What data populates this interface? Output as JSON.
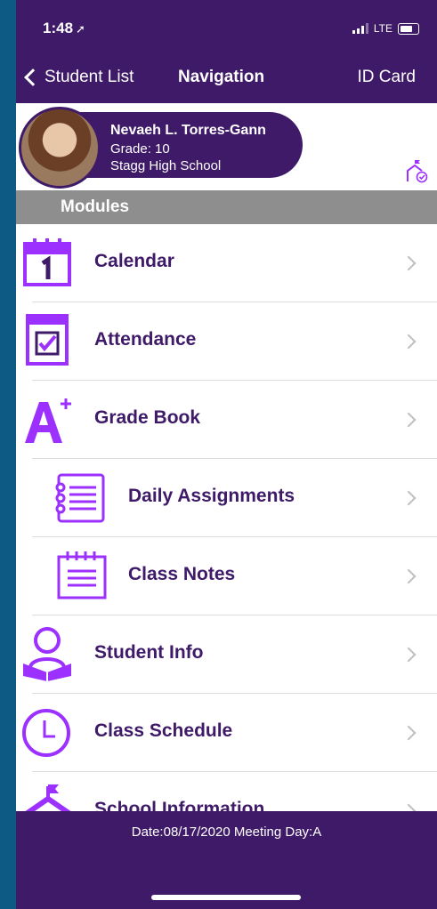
{
  "status": {
    "time": "1:48",
    "network": "LTE"
  },
  "nav": {
    "back_label": "Student List",
    "title": "Navigation",
    "right_label": "ID Card"
  },
  "student": {
    "name": "Nevaeh L. Torres-Gann",
    "grade": "Grade: 10",
    "school": "Stagg High School"
  },
  "section": {
    "title": "Modules"
  },
  "modules": [
    {
      "label": "Calendar",
      "icon": "calendar-icon"
    },
    {
      "label": "Attendance",
      "icon": "attendance-icon"
    },
    {
      "label": "Grade Book",
      "icon": "grade-book-icon"
    },
    {
      "label": "Daily Assignments",
      "icon": "daily-assignments-icon"
    },
    {
      "label": "Class Notes",
      "icon": "class-notes-icon"
    },
    {
      "label": "Student Info",
      "icon": "student-info-icon"
    },
    {
      "label": "Class Schedule",
      "icon": "clock-icon"
    },
    {
      "label": "School Information",
      "icon": "school-icon"
    }
  ],
  "footer": {
    "date_text": "Date:08/17/2020 Meeting Day:A"
  },
  "colors": {
    "primary": "#3e1a68",
    "accent": "#9b30ff",
    "outer": "#0d5a84"
  }
}
